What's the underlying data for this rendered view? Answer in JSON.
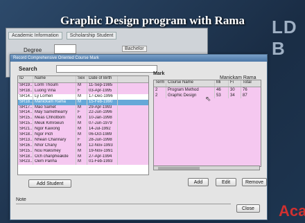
{
  "overlay_title": "Graphic Design program with Rama",
  "background": {
    "tabs": [
      "Academic Information",
      "Scholarship Student"
    ],
    "degree_label": "Degree",
    "bachelor_label": "Bachelor",
    "brand_right": "LD B",
    "brand_bottom": "Aca"
  },
  "dialog": {
    "title": "Record Comprehensive Oriented Course Mark",
    "search_label": "Search",
    "search_value": "",
    "student_columns": [
      "ID",
      "Name",
      "Sex",
      "Date of Birth"
    ],
    "students": [
      {
        "id": "SR19...",
        "name": "Lorm Thoum",
        "sex": "M",
        "dob": "11-Sep-1985"
      },
      {
        "id": "SR18...",
        "name": "Luong Vina",
        "sex": "F",
        "dob": "03-Apr-1995"
      },
      {
        "id": "SR14...",
        "name": "Ly Lorhen",
        "sex": "M",
        "dob": "17-Dec-1996"
      },
      {
        "id": "SR18...",
        "name": "Manickam Rama",
        "sex": "M",
        "dob": "15-Feb-1990"
      },
      {
        "id": "SR17...",
        "name": "Mao Samet",
        "sex": "M",
        "dob": "29-Apr-1993"
      },
      {
        "id": "SR14...",
        "name": "May Samethearry",
        "sex": "F",
        "dob": "22-Jun-1996"
      },
      {
        "id": "SR15...",
        "name": "Meas Chhotbom",
        "sex": "M",
        "dob": "10-Jan-1998"
      },
      {
        "id": "SR15...",
        "name": "Meuk Kimroeun",
        "sex": "M",
        "dob": "07-Jun-1979"
      },
      {
        "id": "SR21...",
        "name": "Ngor Kaviong",
        "sex": "M",
        "dob": "14-Jul-1992"
      },
      {
        "id": "SR18...",
        "name": "Ngor Pich",
        "sex": "M",
        "dob": "06-Oct-1989"
      },
      {
        "id": "SR13...",
        "name": "Nhean Channary",
        "sex": "F",
        "dob": "28-Jun-1998"
      },
      {
        "id": "SR16...",
        "name": "Nhor Chany",
        "sex": "M",
        "dob": "12-Nov-1993"
      },
      {
        "id": "SR15...",
        "name": "Nou Raksmey",
        "sex": "M",
        "dob": "19-Nov-1991"
      },
      {
        "id": "SR18...",
        "name": "Och chanpheakde",
        "sex": "M",
        "dob": "27-Apr-1994"
      },
      {
        "id": "SR23...",
        "name": "Oem Panha",
        "sex": "M",
        "dob": "01-Feb-1993"
      }
    ],
    "mark_label": "Mark",
    "selected_student": "Manickam Rama",
    "mark_columns": [
      "Term",
      "Course Name",
      "Mi",
      "Fi",
      "Total"
    ],
    "marks": [
      {
        "term": "2",
        "course": "Program Method",
        "mi": "46",
        "fi": "30",
        "total": "76"
      },
      {
        "term": "2",
        "course": "Graphic Design",
        "mi": "53",
        "fi": "34",
        "total": "87"
      }
    ],
    "buttons": {
      "add_student": "Add Student",
      "add": "Add",
      "edit": "Edit",
      "remove": "Remove",
      "close": "Close"
    },
    "note_label": "Note"
  }
}
